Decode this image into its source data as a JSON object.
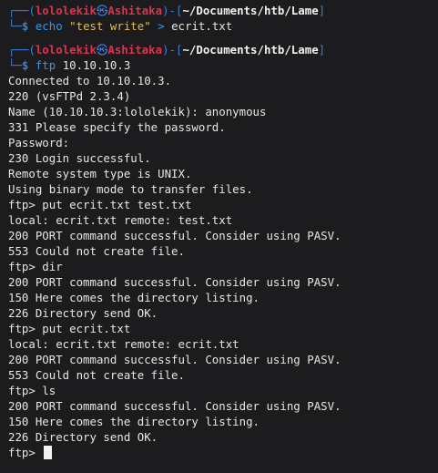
{
  "prompt1": {
    "user": "lololekik",
    "separator_icon": "skull-icon",
    "host": "Ashitaka",
    "path": "~/Documents/htb/Lame",
    "cmd": "echo",
    "string": "\"test write\"",
    "op": ">",
    "arg": "ecrit.txt"
  },
  "prompt2": {
    "user": "lololekik",
    "separator_icon": "skull-icon",
    "host": "Ashitaka",
    "path": "~/Documents/htb/Lame",
    "cmd": "ftp",
    "arg": "10.10.10.3"
  },
  "output": [
    "Connected to 10.10.10.3.",
    "220 (vsFTPd 2.3.4)",
    "Name (10.10.10.3:lololekik): anonymous",
    "331 Please specify the password.",
    "Password:",
    "230 Login successful.",
    "Remote system type is UNIX.",
    "Using binary mode to transfer files.",
    "ftp> put ecrit.txt test.txt",
    "local: ecrit.txt remote: test.txt",
    "200 PORT command successful. Consider using PASV.",
    "553 Could not create file.",
    "ftp> dir",
    "200 PORT command successful. Consider using PASV.",
    "150 Here comes the directory listing.",
    "226 Directory send OK.",
    "ftp> put ecrit.txt",
    "local: ecrit.txt remote: ecrit.txt",
    "200 PORT command successful. Consider using PASV.",
    "553 Could not create file.",
    "ftp> ls",
    "200 PORT command successful. Consider using PASV.",
    "150 Here comes the directory listing.",
    "226 Directory send OK."
  ],
  "final_prompt": "ftp> ",
  "colors": {
    "background": "#1c1c1f",
    "user": "#e0314f",
    "frame": "#3b7fd6",
    "command": "#2f9be8",
    "string": "#e6b85c"
  }
}
